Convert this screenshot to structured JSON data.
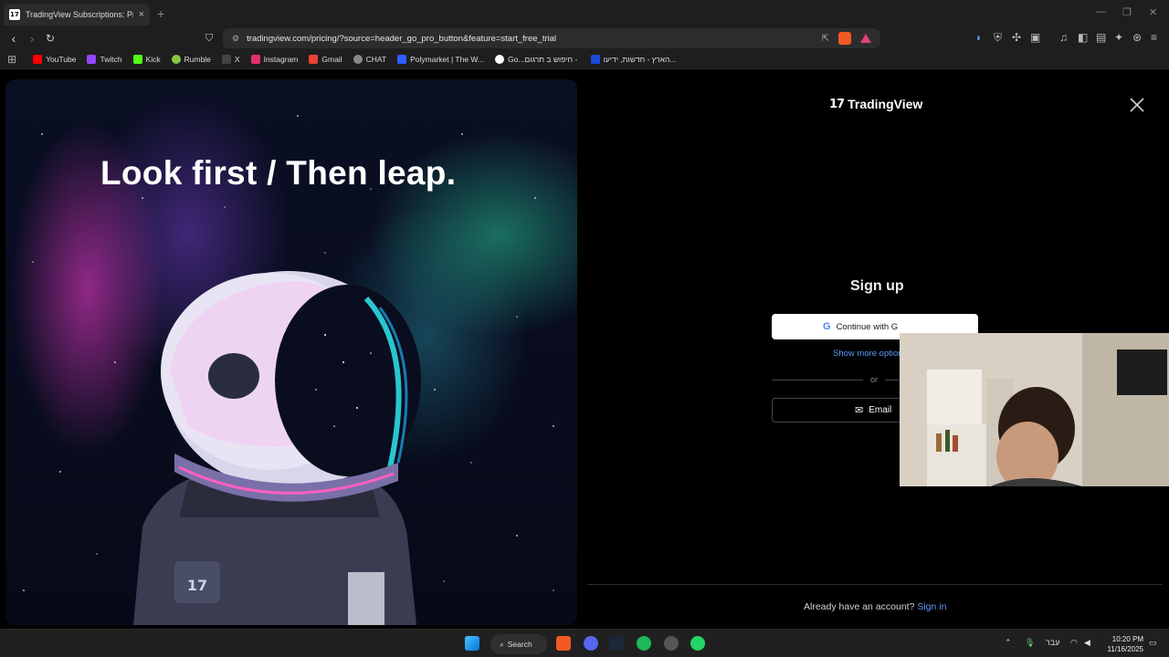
{
  "browser": {
    "tab_title": "TradingView Subscriptions: Pricin",
    "tab_favicon": "17",
    "tab_close": "×",
    "new_tab": "+",
    "url": "tradingview.com/pricing/?source=header_go_pro_button&feature=start_free_trial",
    "bookmarks": [
      {
        "label": "YouTube",
        "color": "#ff0000"
      },
      {
        "label": "Twitch",
        "color": "#9146ff"
      },
      {
        "label": "Kick",
        "color": "#53fc18"
      },
      {
        "label": "Rumble",
        "color": "#85c742"
      },
      {
        "label": "X",
        "color": "#444444"
      },
      {
        "label": "Instagram",
        "color": "#e1306c"
      },
      {
        "label": "Gmail",
        "color": "#ea4335"
      },
      {
        "label": "CHAT",
        "color": "#888888"
      },
      {
        "label": "Polymarket | The W...",
        "color": "#2e5cff"
      },
      {
        "label": "Go...‏ - חיפוש ב‏ תרגום",
        "color": "#ffffff"
      },
      {
        "label": "הארץ - חדשות, ידיעו...",
        "color": "#1a4ad8"
      }
    ]
  },
  "page": {
    "headline": "Look first / Then leap.",
    "brand": "TradingView",
    "brand_mark": "17",
    "signup_title": "Sign up",
    "google_button": "Continue with G",
    "more_options": "Show more options",
    "or_label": "or",
    "email_button": "Email",
    "already_text": "Already have an account?",
    "signin_link": "Sign in"
  },
  "taskbar": {
    "search_label": "Search",
    "lang": "עבר",
    "time": "10:20 PM",
    "date": "11/16/2025"
  },
  "colors": {
    "accent_blue": "#5b9cf6",
    "background": "#000000"
  }
}
